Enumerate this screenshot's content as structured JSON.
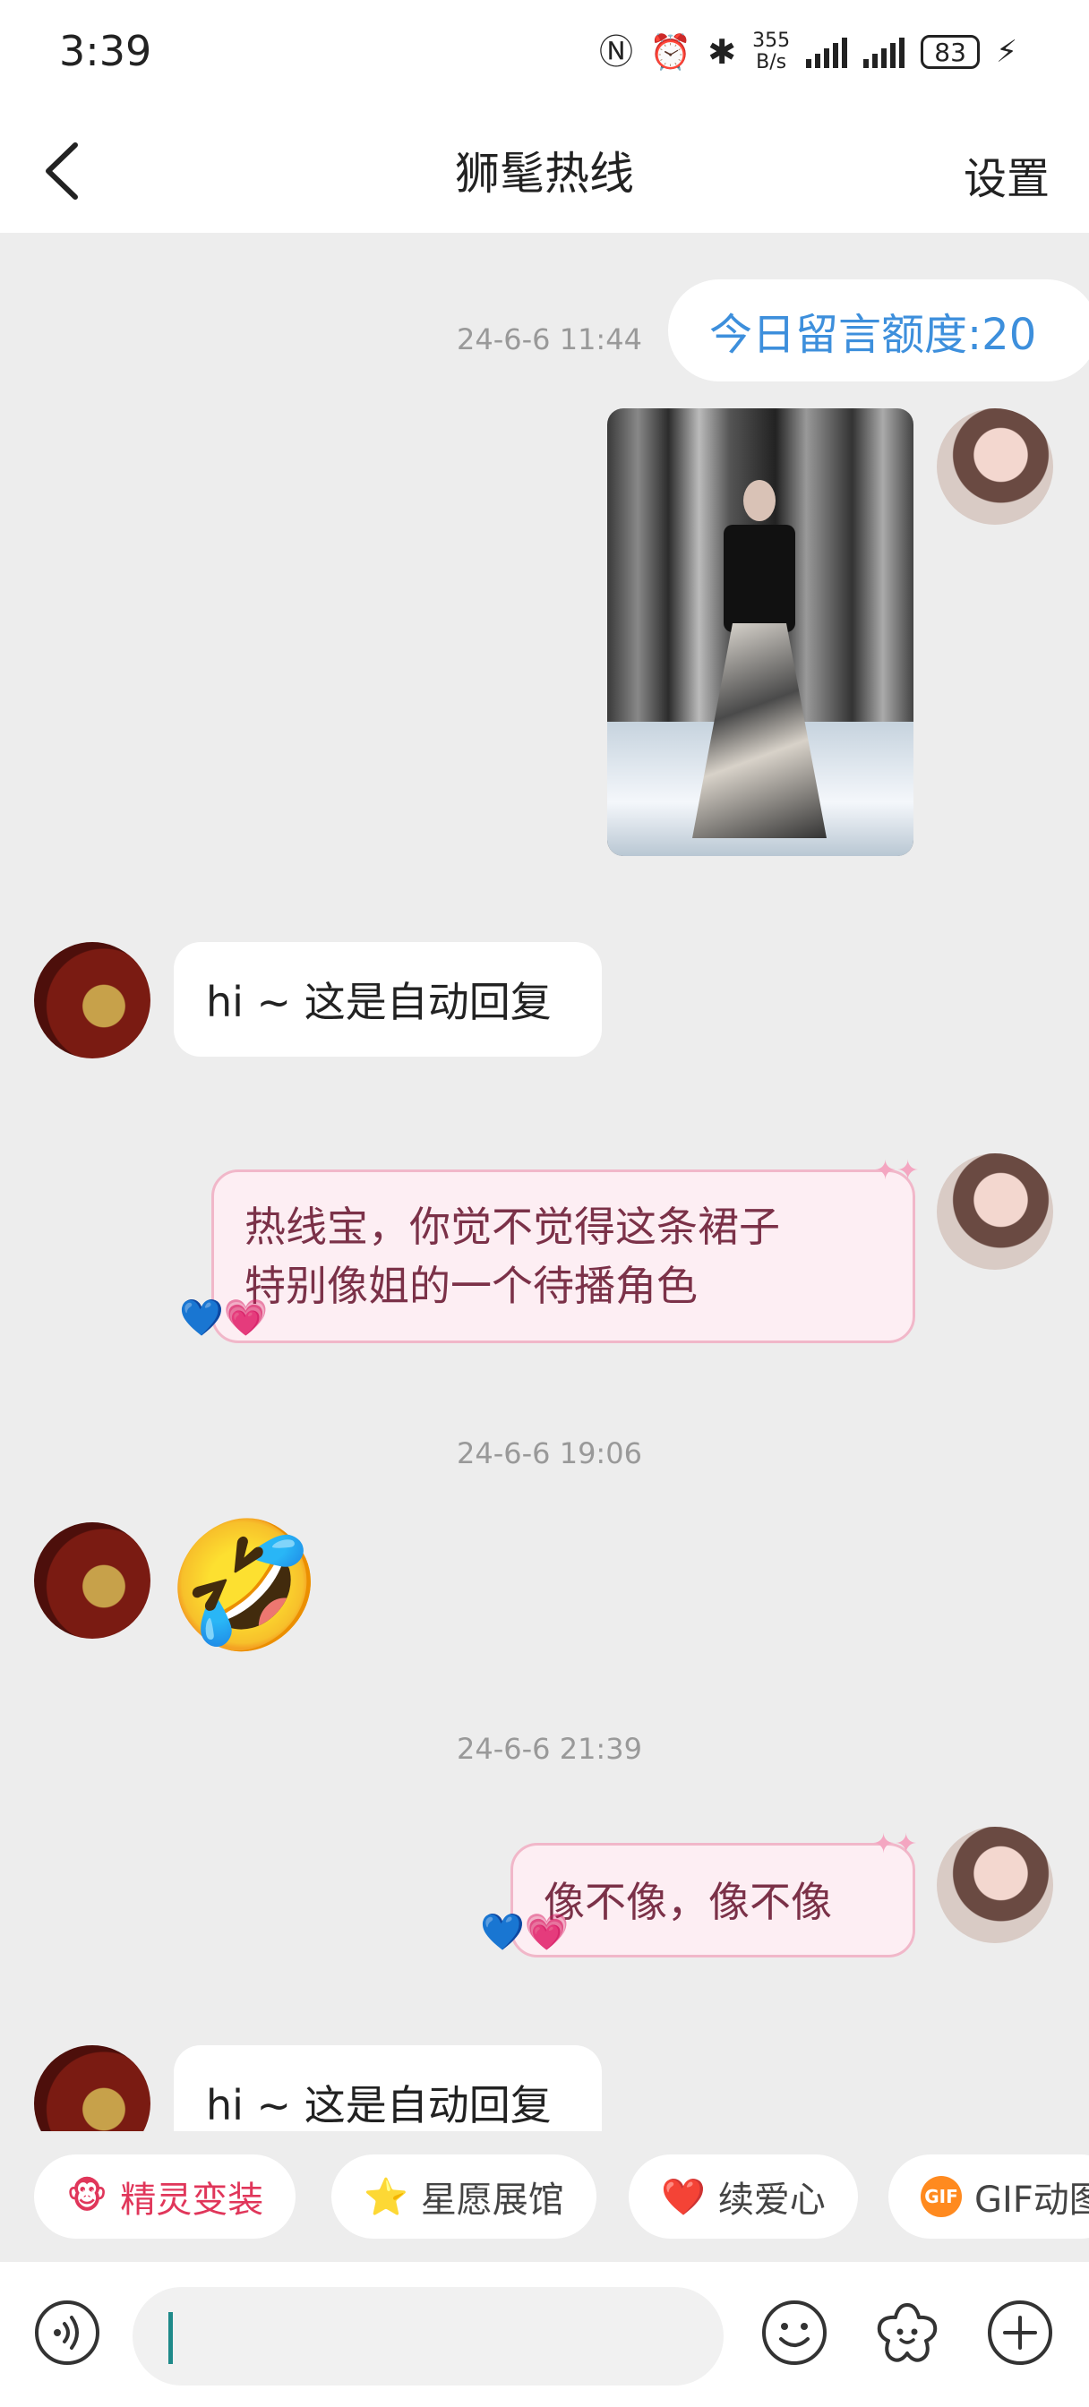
{
  "status_bar": {
    "time": "3:39",
    "net_speed_value": "355",
    "net_speed_unit": "B/s",
    "battery": "83",
    "icons": [
      "nfc-icon",
      "alarm-icon",
      "bluetooth-icon",
      "signal-icon",
      "signal-icon",
      "battery-icon",
      "charging-icon"
    ]
  },
  "header": {
    "title": "狮髦热线",
    "settings_label": "设置",
    "back_icon": "chevron-left-icon"
  },
  "chat": {
    "quota_text": "今日留言额度:20",
    "messages": [
      {
        "timestamp": "24-6-6 11:44"
      },
      {
        "sender": "user",
        "type": "image",
        "image_desc": "runway-dress-photo"
      },
      {
        "sender": "bot",
        "text": "hi ~ 这是自动回复"
      },
      {
        "sender": "user",
        "text_line1": "热线宝，你觉不觉得这条裙子",
        "text_line2": "特别像姐的一个待播角色"
      },
      {
        "timestamp": "24-6-6 19:06"
      },
      {
        "sender": "bot",
        "type": "emoji",
        "text": "🤣"
      },
      {
        "timestamp": "24-6-6 21:39"
      },
      {
        "sender": "user",
        "text": "像不像，像不像"
      },
      {
        "sender": "bot",
        "text": "hi ~ 这是自动回复"
      }
    ]
  },
  "quick_actions": [
    {
      "label": "精灵变装",
      "icon": "monkey-face-icon",
      "color": "#e0365a"
    },
    {
      "label": "星愿展馆",
      "icon": "star-icon",
      "color": "#444444"
    },
    {
      "label": "续爱心",
      "icon": "heart-icon",
      "color": "#444444"
    },
    {
      "label": "GIF动图",
      "icon": "gif-icon",
      "badge": "GIF",
      "color": "#444444"
    }
  ],
  "input_bar": {
    "voice_icon": "voice-icon",
    "emoji_icon": "smiley-icon",
    "sticker_icon": "flower-icon",
    "plus_icon": "plus-icon",
    "placeholder": ""
  },
  "colors": {
    "accent_blue": "#3d8fdc",
    "pink_bubble_bg": "#fdeef3",
    "pink_bubble_text": "#7b3148",
    "chat_bg": "#ededed"
  }
}
